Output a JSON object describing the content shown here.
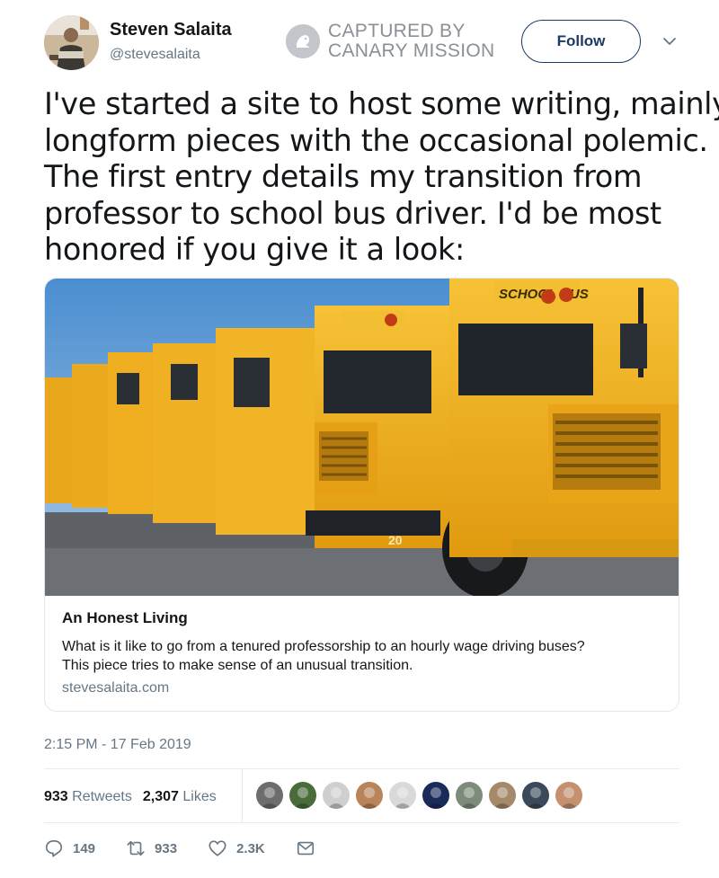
{
  "user": {
    "name": "Steven Salaita",
    "handle": "@stevesalaita"
  },
  "captured": {
    "line1": "CAPTURED BY",
    "line2": "CANARY MISSION"
  },
  "follow_label": "Follow",
  "tweet": {
    "lines": [
      "I've started a site to host some writing, mainly",
      "longform pieces with the occasional polemic.",
      "The first entry details my transition from",
      "professor to school bus driver.  I'd be most",
      "honored if you give it a look:"
    ]
  },
  "card": {
    "image_alt": "A row of yellow school buses",
    "bus_label": "SCHOOL BUS",
    "bus_number": "20",
    "title": "An Honest Living",
    "description_line1": "What is it like to go from a tenured professorship to an hourly wage driving buses?",
    "description_line2": "This piece tries to make sense of an unusual transition.",
    "url": "stevesalaita.com"
  },
  "timestamp": "2:15 PM - 17 Feb 2019",
  "stats": {
    "retweets_count": "933",
    "retweets_label": "Retweets",
    "likes_count": "2,307",
    "likes_label": "Likes"
  },
  "likers": [
    "#6d6d6d",
    "#4a6b3a",
    "#cfcfcf",
    "#b8855a",
    "#d9d9d9",
    "#1a2b5a",
    "#7d8c7a",
    "#a58a6a",
    "#3a4a5a",
    "#c49070"
  ],
  "actions": {
    "replies": "149",
    "retweets": "933",
    "likes": "2.3K"
  },
  "colors": {
    "accent": "#1b3a66",
    "muted": "#657786",
    "bus_yellow": "#f2b21e"
  }
}
